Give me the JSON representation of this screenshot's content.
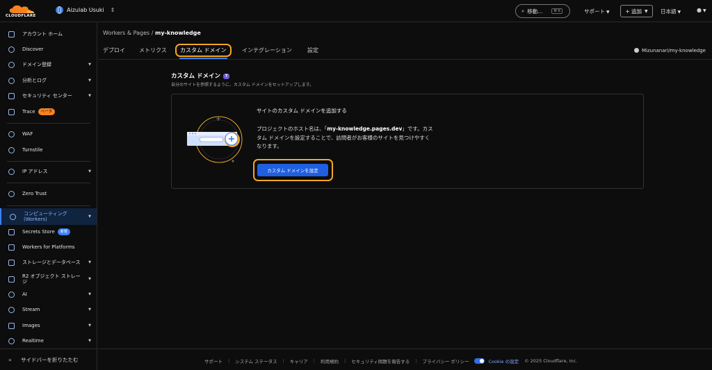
{
  "topbar": {
    "logo_text": "CLOUDFLARE",
    "account_name": "Aizulab Usuki",
    "search_label": "移動...",
    "search_shortcut": "⌘ K",
    "support_label": "サポート",
    "add_label": "+ 追加",
    "language_label": "日本語"
  },
  "sidebar": {
    "items": [
      {
        "label": "アカウント ホーム"
      },
      {
        "label": "Discover"
      },
      {
        "label": "ドメイン登録"
      },
      {
        "label": "分析とログ"
      },
      {
        "label": "セキュリティ センター"
      },
      {
        "label": "Trace",
        "badge": "ベータ"
      },
      {
        "label": "WAF"
      },
      {
        "label": "Turnstile"
      },
      {
        "label": "IP アドレス"
      },
      {
        "label": "Zero Trust"
      },
      {
        "label": "コンピューティング (Workers)"
      },
      {
        "label": "Secrets Store",
        "badge": "新規"
      },
      {
        "label": "Workers for Platforms"
      },
      {
        "label": "ストレージとデータベース"
      },
      {
        "label": "R2 オブジェクト ストレージ"
      },
      {
        "label": "AI"
      },
      {
        "label": "Stream"
      },
      {
        "label": "Images"
      },
      {
        "label": "Realtime"
      }
    ],
    "collapse_label": "サイドバーを折りたたむ"
  },
  "main": {
    "breadcrumb_parent": "Workers & Pages",
    "breadcrumb_current": "my-knowledge",
    "tabs": [
      {
        "label": "デプロイ"
      },
      {
        "label": "メトリクス"
      },
      {
        "label": "カスタム ドメイン"
      },
      {
        "label": "インテグレーション"
      },
      {
        "label": "設定"
      }
    ],
    "repo": "Mizunanari/my-knowledge",
    "section_title": "カスタム ドメイン",
    "section_tag": "T",
    "section_desc": "自分のサイトを参照するように、カスタム ドメインをセットアップします。",
    "card": {
      "title": "サイトのカスタム ドメインを追加する",
      "text_before": "プロジェクトのホスト名は、「",
      "hostname": "my-knowledge.pages.dev",
      "text_after": "」です。カスタム ドメインを設定することで、訪問者がお客様のサイトを見つけやすくなります。",
      "button_label": "カスタム ドメインを設定"
    }
  },
  "footer": {
    "links": [
      "サポート",
      "システム ステータス",
      "キャリア",
      "利用規約",
      "セキュリティ問題を報告する",
      "プライバシー ポリシー"
    ],
    "cookie_label": "Cookie の設定",
    "copyright": "© 2025 Cloudflare, Inc."
  },
  "colors": {
    "accent": "#3b82f6",
    "highlight": "#f6a623",
    "brand_orange": "#f6821f"
  }
}
